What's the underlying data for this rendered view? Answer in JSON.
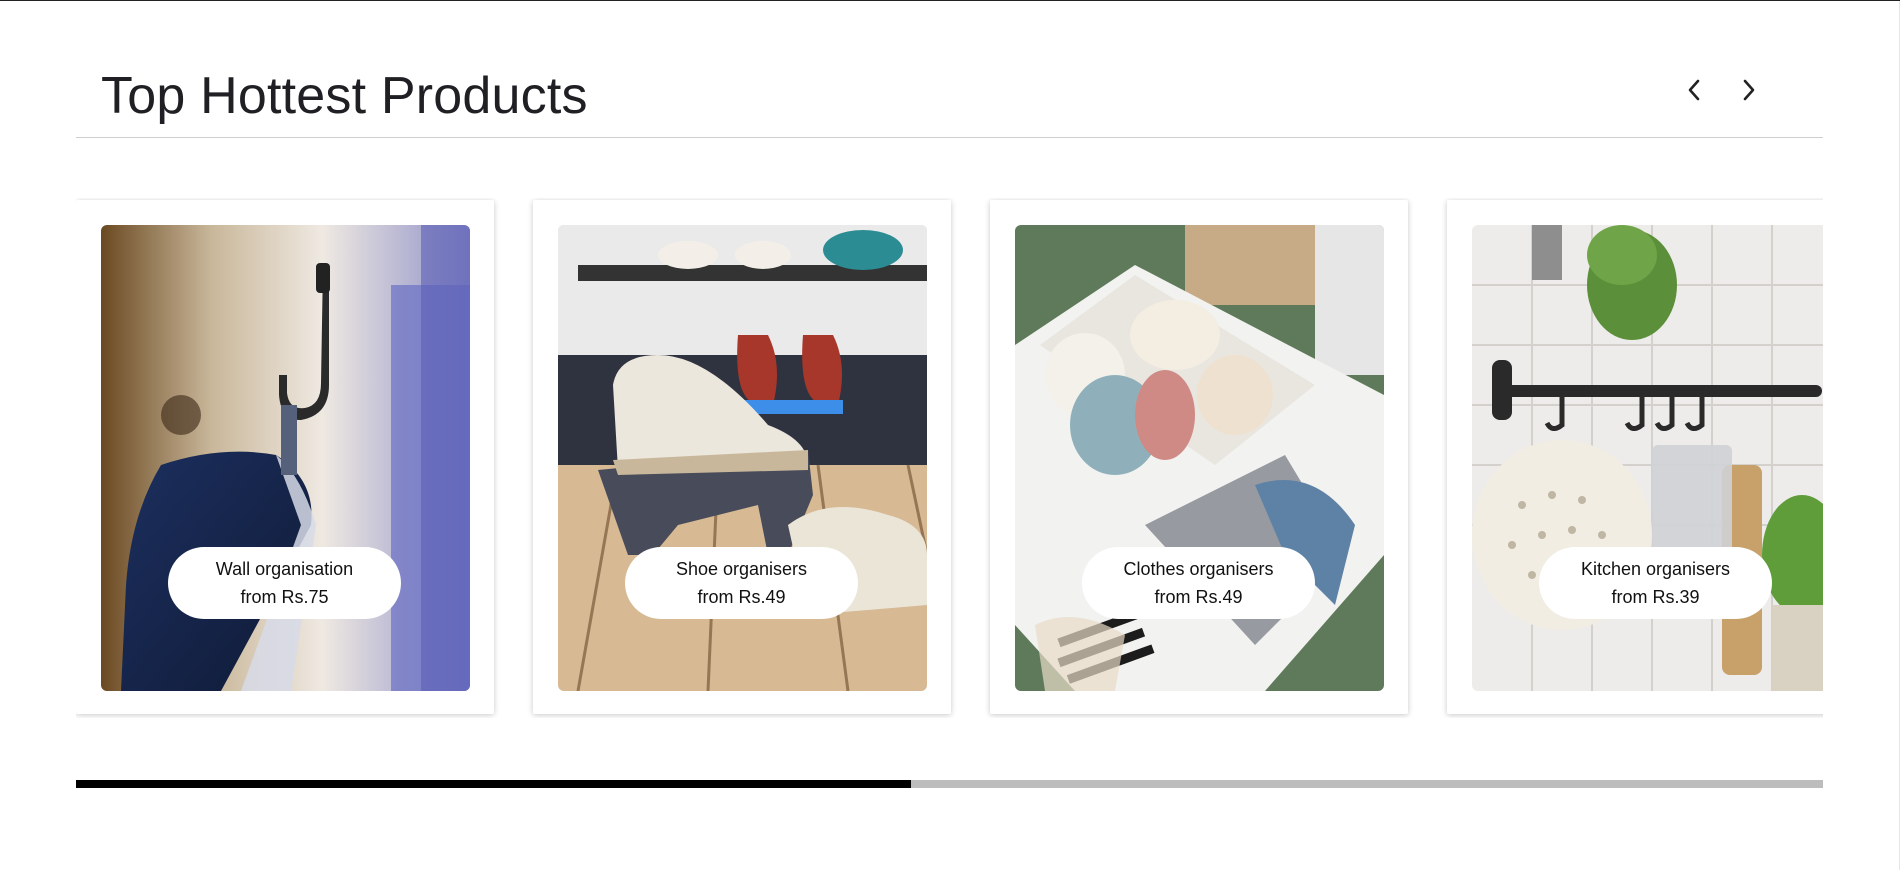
{
  "section": {
    "title": "Top Hottest Products",
    "prev_icon": "chevron-left-icon",
    "next_icon": "chevron-right-icon"
  },
  "products": [
    {
      "name": "Wall organisation",
      "price": "from Rs.75",
      "image": "wall-hook-photo"
    },
    {
      "name": "Shoe organisers",
      "price": "from Rs.49",
      "image": "shoe-organiser-photo"
    },
    {
      "name": "Clothes organisers",
      "price": "from Rs.49",
      "image": "clothes-box-photo"
    },
    {
      "name": "Kitchen organisers",
      "price": "from Rs.39",
      "image": "kitchen-rail-photo"
    }
  ],
  "scroll_progress": 0.478,
  "colors": {
    "title": "#1f1f24",
    "progress_fill": "#000000",
    "progress_track": "#bdbdbd"
  }
}
